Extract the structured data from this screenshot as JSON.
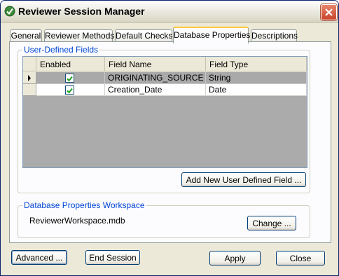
{
  "window": {
    "title": "Reviewer Session Manager"
  },
  "tabs": [
    {
      "label": "General"
    },
    {
      "label": "Reviewer Methods"
    },
    {
      "label": "Default Checks"
    },
    {
      "label": "Database Properties"
    },
    {
      "label": "Descriptions"
    }
  ],
  "active_tab": "Database Properties",
  "user_defined_fields": {
    "title": "User-Defined Fields",
    "columns": [
      "Enabled",
      "Field Name",
      "Field Type"
    ],
    "rows": [
      {
        "enabled": true,
        "field_name": "ORIGINATING_SOURCE",
        "field_type": "String",
        "selected": true
      },
      {
        "enabled": true,
        "field_name": "Creation_Date",
        "field_type": "Date",
        "selected": false
      }
    ],
    "add_button": "Add New User Defined Field ..."
  },
  "workspace": {
    "title": "Database Properties Workspace",
    "value": "ReviewerWorkspace.mdb",
    "change_button": "Change ..."
  },
  "footer": {
    "advanced": "Advanced ...",
    "end_session": "End Session",
    "apply": "Apply",
    "close": "Close"
  },
  "colors": {
    "accent": "#0046d5",
    "selected_row": "#a9a9a9",
    "tab_highlight": "#ffc83c"
  }
}
